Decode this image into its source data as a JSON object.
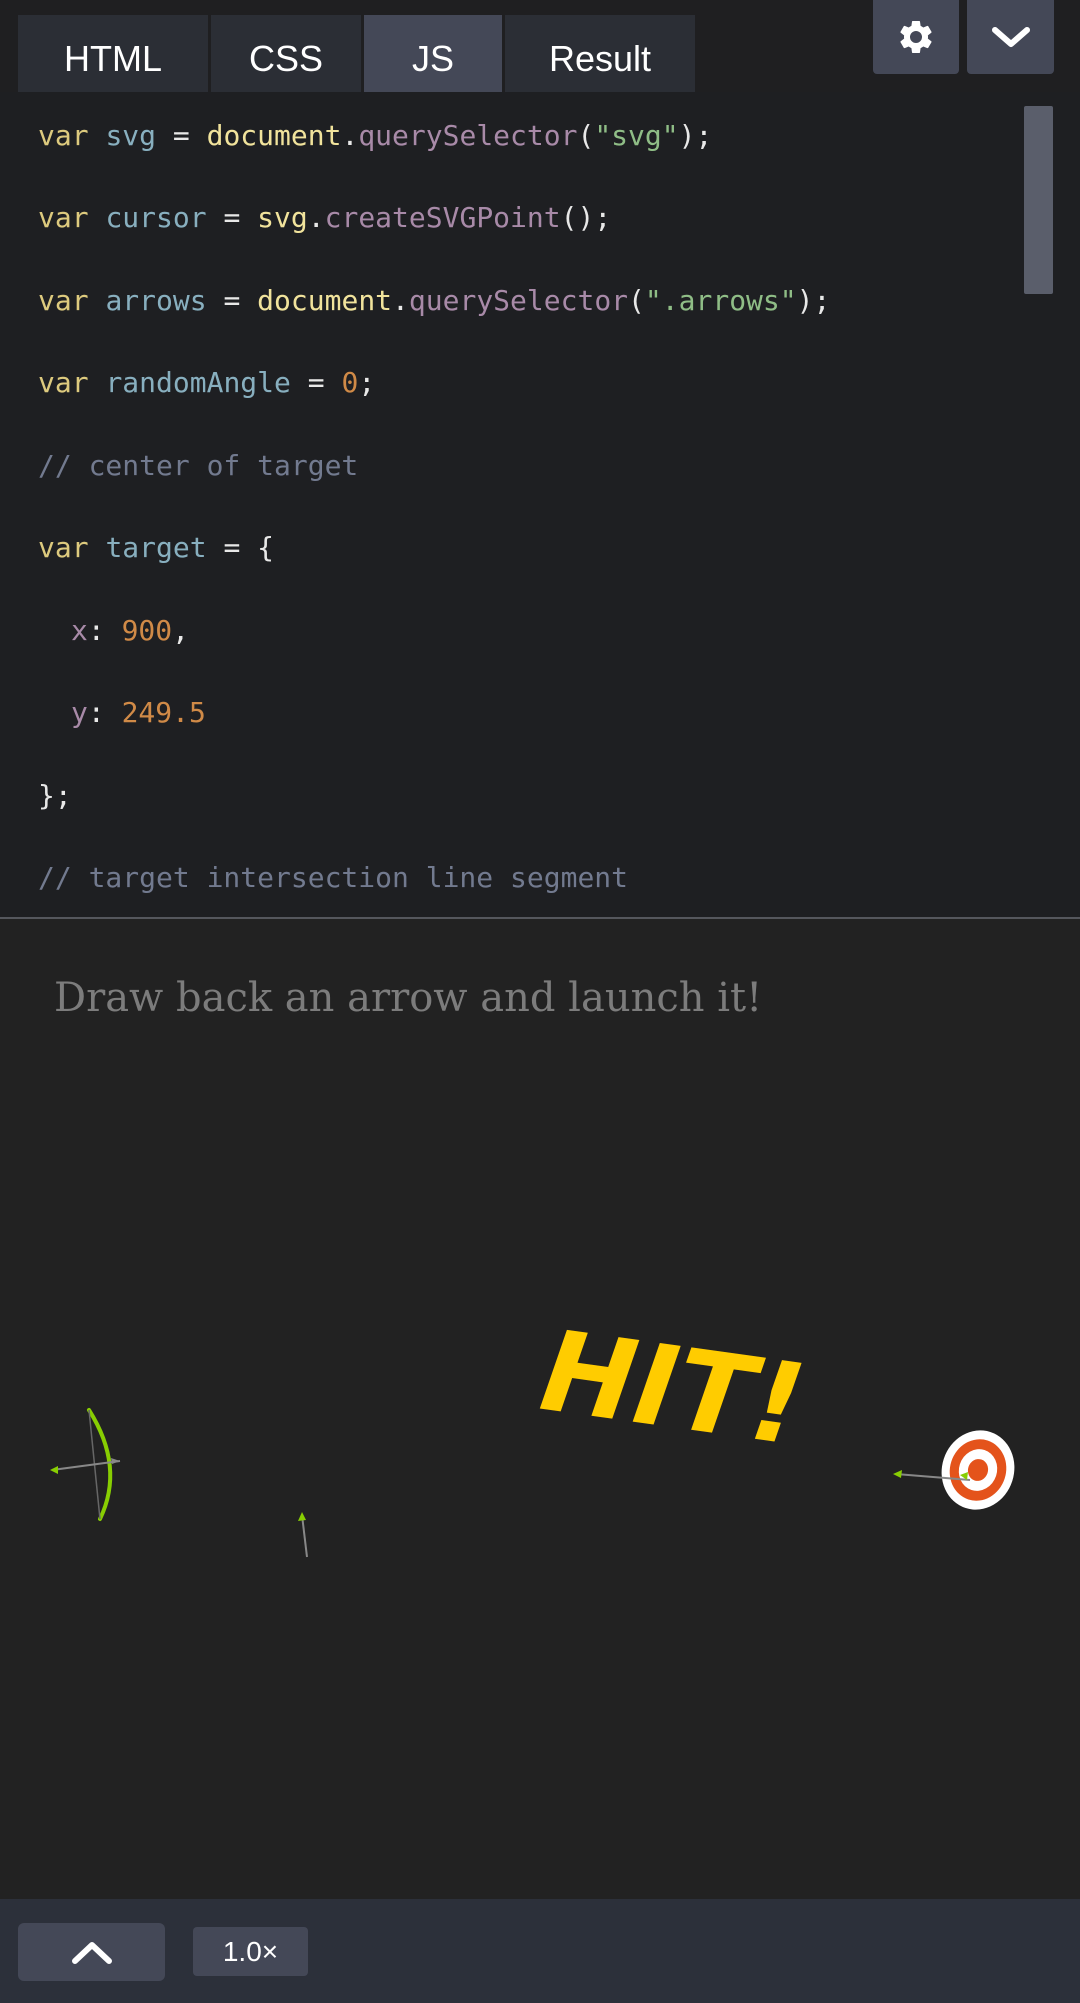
{
  "tabs": [
    {
      "label": "HTML"
    },
    {
      "label": "CSS"
    },
    {
      "label": "JS"
    },
    {
      "label": "Result"
    }
  ],
  "active_tab": "JS",
  "icons": {
    "settings": "gear-icon",
    "collapse": "chevron-down-icon",
    "expand": "chevron-up-icon"
  },
  "code": {
    "line1": {
      "kw": "var",
      "name": "svg",
      "eq": " = ",
      "obj": "document",
      "dot": ".",
      "fn": "querySelector",
      "open": "(",
      "str": "\"svg\"",
      "close": ");"
    },
    "line2": {
      "kw": "var",
      "name": "cursor",
      "eq": " = ",
      "obj": "svg",
      "dot": ".",
      "fn": "createSVGPoint",
      "close": "();"
    },
    "line3": {
      "kw": "var",
      "name": "arrows",
      "eq": " = ",
      "obj": "document",
      "dot": ".",
      "fn": "querySelector",
      "open": "(",
      "str": "\".arrows\"",
      "close": ");"
    },
    "line4": {
      "kw": "var",
      "name": "randomAngle",
      "eq": " = ",
      "num": "0",
      "close": ";"
    },
    "line5": {
      "comment": "// center of target"
    },
    "line6": {
      "kw": "var",
      "name": "target",
      "rest": " = {"
    },
    "line7": {
      "prop": "x",
      "colon": ": ",
      "num": "900",
      "close": ","
    },
    "line8": {
      "prop": "y",
      "colon": ": ",
      "num": "249.5"
    },
    "line9": {
      "text": "};"
    },
    "line10": {
      "comment": "// target intersection line segment"
    }
  },
  "result": {
    "prompt": "Draw back an arrow and launch it!",
    "hit_text": "HIT!"
  },
  "footer": {
    "zoom": "1.0×"
  },
  "colors": {
    "bow": "#88ce02",
    "hit": "#ffcc00",
    "target_red": "#e4531b",
    "arrow_shaft": "#888888"
  }
}
